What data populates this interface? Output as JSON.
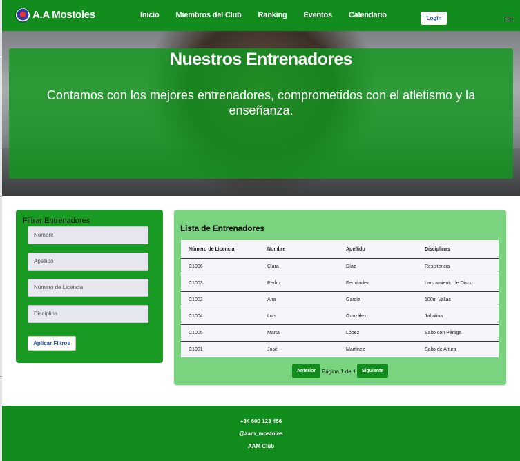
{
  "navbar": {
    "brand": "A.A Mostoles",
    "links": [
      "Inicio",
      "Miembros del Club",
      "Ranking",
      "Eventos",
      "Calendario"
    ],
    "login_label": "Login"
  },
  "hero": {
    "title": "Nuestros Entrenadores",
    "subtitle": "Contamos con los mejores entrenadores, comprometidos con el atletismo y la enseñanza."
  },
  "filters": {
    "title": "Filtrar Entrenadores",
    "nombre_placeholder": "Nombre",
    "apellido_placeholder": "Apellido",
    "licencia_placeholder": "Número de Licencia",
    "disciplina_placeholder": "Disciplina",
    "apply_label": "Aplicar Filtros"
  },
  "list": {
    "title": "Lista de Entrenadores",
    "columns": [
      "Número de Licencia",
      "Nombre",
      "Apellido",
      "Disciplinas"
    ],
    "rows": [
      [
        "C1006",
        "Clara",
        "Díaz",
        "Resistencia"
      ],
      [
        "C1003",
        "Pedro",
        "Fernández",
        "Lanzamiento de Disco"
      ],
      [
        "C1002",
        "Ana",
        "García",
        "100m Vallas"
      ],
      [
        "C1004",
        "Luis",
        "González",
        "Jabalina"
      ],
      [
        "C1005",
        "Marta",
        "López",
        "Salto con Pértiga"
      ],
      [
        "C1001",
        "José",
        "Martínez",
        "Salto de Altura"
      ]
    ],
    "pager": {
      "prev_label": "Anterior",
      "info": "Página 1 de 1",
      "next_label": "Siguiente"
    }
  },
  "footer": {
    "phone": "+34 600 123 456",
    "handle": "@aam_mostoles",
    "club": "AAM Club"
  },
  "colors": {
    "brand_green": "#128d1d",
    "panel_green": "#189a23",
    "list_green": "#7ad37f",
    "button_text_blue": "#1f4f97"
  },
  "icons": [
    "club-logo-icon",
    "hamburger-menu-icon"
  ]
}
